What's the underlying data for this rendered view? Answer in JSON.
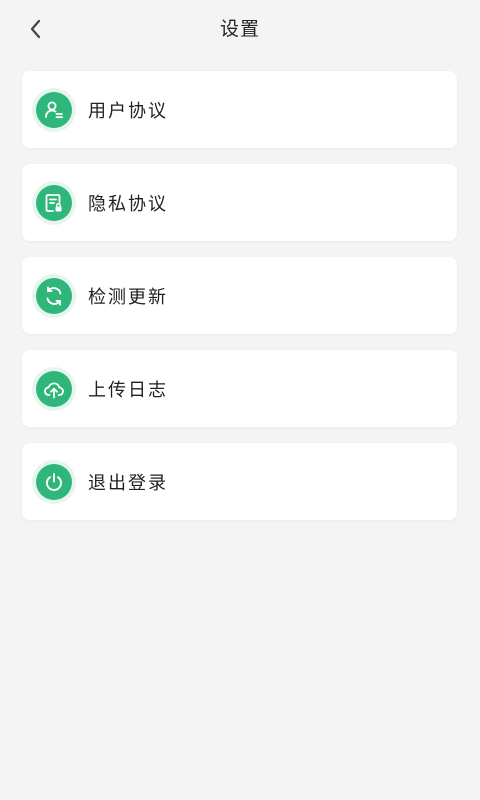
{
  "header": {
    "title": "设置",
    "back_icon": "chevron-left-icon"
  },
  "menu": {
    "items": [
      {
        "label": "用户协议",
        "icon": "user-agreement-icon"
      },
      {
        "label": "隐私协议",
        "icon": "privacy-document-icon"
      },
      {
        "label": "检测更新",
        "icon": "refresh-icon"
      },
      {
        "label": "上传日志",
        "icon": "cloud-upload-icon"
      },
      {
        "label": "退出登录",
        "icon": "power-icon"
      }
    ]
  },
  "colors": {
    "accent": "#2fb67a",
    "background": "#f4f4f4",
    "card": "#ffffff",
    "text": "#222222"
  }
}
